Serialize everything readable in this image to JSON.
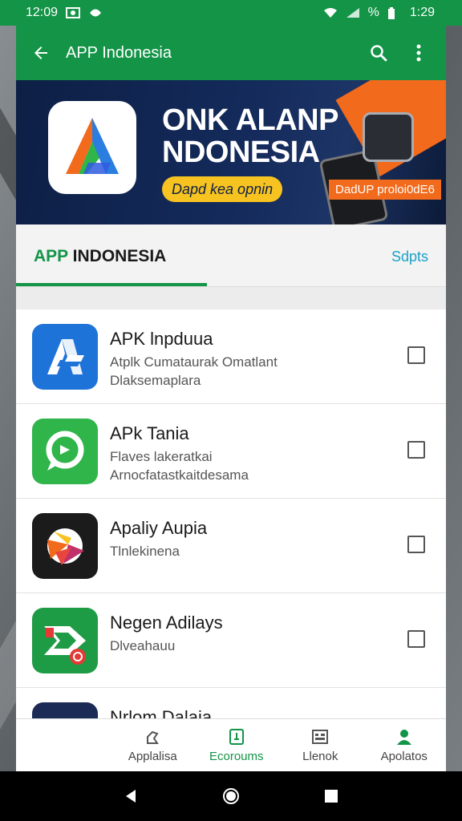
{
  "status_bar": {
    "time_left": "12:09",
    "indicators": "%",
    "time_right": "1:29"
  },
  "toolbar": {
    "title": "APP Indonesia",
    "icons": [
      "arrow-back-icon",
      "search-icon",
      "more-vert-icon"
    ]
  },
  "banner": {
    "headline_line1": "ONK ALANP",
    "headline_line2": "NDONESIA",
    "pill_text": "Dapd kea opnin",
    "promo_text": "DadUP proloi0dE6"
  },
  "section": {
    "title_app": "APP",
    "title_rest": " INDONESIA",
    "action": "Sdpts"
  },
  "apps": [
    {
      "name": "APK lnpduua",
      "desc1": "Atplk Cumataurak Omatlant",
      "desc2": "Dlaksemaplara",
      "icon": "blue-a-logo-icon",
      "color": "#1e73d8"
    },
    {
      "name": "APk Tania",
      "desc1": "Flaves lakeratkai",
      "desc2": "Arnocfatastkaitdesama",
      "icon": "green-chat-logo-icon",
      "color": "#2fb54a"
    },
    {
      "name": "Apaliy Aupia",
      "desc1": "Tlnlekinena",
      "desc2": "",
      "icon": "multicolor-logo-icon",
      "color": "#1b1b1b"
    },
    {
      "name": "Negen Adilays",
      "desc1": "Dlveahauu",
      "desc2": "",
      "icon": "green-play-logo-icon",
      "color": "#1e9b45"
    },
    {
      "name": "Nrlom Dalaia",
      "desc1": "",
      "desc2": "",
      "icon": "blue-red-logo-icon",
      "color": "#1b2b55"
    }
  ],
  "bottom_nav": [
    {
      "label": "Applalisa",
      "icon": "apps-icon",
      "active": false
    },
    {
      "label": "Ecoroums",
      "icon": "document-icon",
      "active": true
    },
    {
      "label": "Llenok",
      "icon": "grid-icon",
      "active": false
    },
    {
      "label": "Apolatos",
      "icon": "person-icon",
      "active": true
    }
  ],
  "colors": {
    "primary": "#139447",
    "accent_orange": "#f26a1b",
    "accent_yellow": "#f7c320",
    "banner_navy": "#0d1f45",
    "link_blue": "#1aa0c8"
  }
}
